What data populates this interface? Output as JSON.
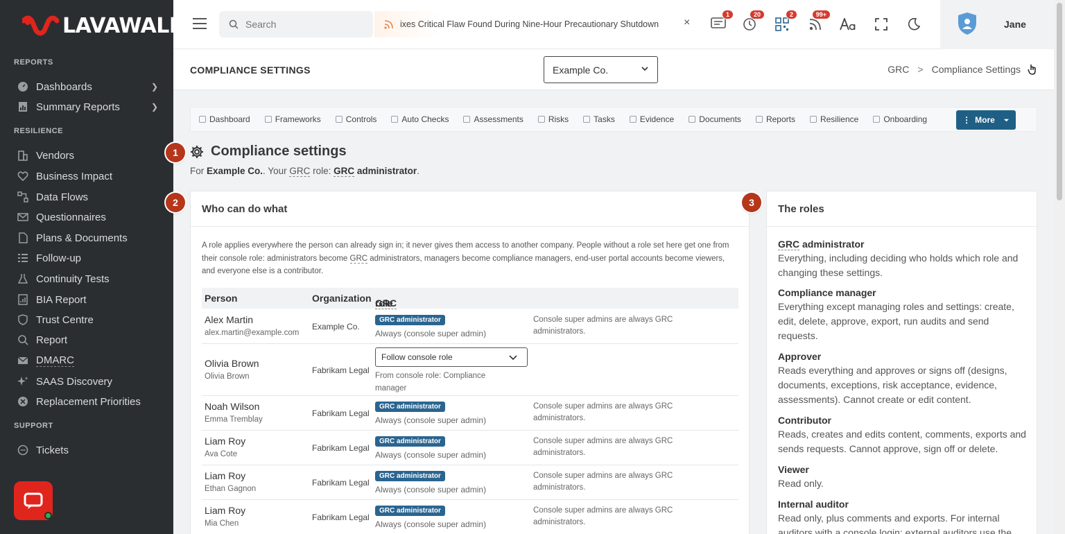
{
  "sidebar": {
    "logo_text": "LAVAWALL",
    "logo_reg": "®",
    "sections": {
      "reports": "REPORTS",
      "resilience": "RESILIENCE",
      "support": "SUPPORT"
    },
    "items": {
      "dashboards": "Dashboards",
      "summary_reports": "Summary Reports",
      "vendors": "Vendors",
      "business_impact": "Business Impact",
      "data_flows": "Data Flows",
      "questionnaires": "Questionnaires",
      "plans_documents": "Plans & Documents",
      "follow_up": "Follow-up",
      "continuity_tests": "Continuity Tests",
      "bia_report": "BIA Report",
      "trust_centre": "Trust Centre",
      "report": "Report",
      "dmarc": "DMARC",
      "saas_discovery": "SAAS Discovery",
      "replacement_priorities": "Replacement Priorities",
      "tickets": "Tickets"
    }
  },
  "topbar": {
    "search_placeholder": "Search",
    "ticker_text": "ixes Critical Flaw Found During Nine-Hour Precautionary Shutdown",
    "ticker_close": "×",
    "badges": {
      "messages": "1",
      "timer": "20",
      "qr": "2",
      "feed": "99+"
    },
    "user_name": "Jane"
  },
  "page_header": {
    "title": "COMPLIANCE SETTINGS",
    "org_selected": "Example Co.",
    "breadcrumb": [
      "GRC",
      "Compliance Settings"
    ],
    "breadcrumb_sep": ">"
  },
  "tabs": {
    "items": [
      "Dashboard",
      "Frameworks",
      "Controls",
      "Auto Checks",
      "Assessments",
      "Risks",
      "Tasks",
      "Evidence",
      "Documents",
      "Reports",
      "Resilience",
      "Onboarding"
    ],
    "more": "More"
  },
  "markers": [
    "1",
    "2",
    "3"
  ],
  "heading": {
    "title": "Compliance settings",
    "sub_prefix": "For ",
    "sub_org": "Example Co.",
    "sub_mid1": ". Your ",
    "sub_grc": "GRC",
    "sub_mid2": " role: ",
    "sub_grc2": "GRC",
    "sub_role": " administrator",
    "sub_end": "."
  },
  "who_card": {
    "title": "Who can do what",
    "intro_1": "A role applies everywhere the person can already sign in; it never gives them access to another company. People without a role set here get one from their console role: administrators become ",
    "intro_grc": "GRC",
    "intro_2": " administrators, managers become compliance managers, end-user portal accounts become viewers, and everyone else is a contributor.",
    "columns": {
      "person": "Person",
      "organization": "Organization",
      "role_grc": "GRC",
      "role": " role"
    },
    "rows": [
      {
        "name": "Alex Martin",
        "sub": "alex.martin@example.com",
        "org": "Example Co.",
        "badge": "GRC administrator",
        "role_sub": "Always (console super admin)",
        "note": "Console super admins are always GRC administrators."
      },
      {
        "name": "Olivia Brown",
        "sub": "Olivia Brown",
        "org": "Fabrikam Legal",
        "select": "Follow console role",
        "role_sub": "From console role: Compliance manager"
      },
      {
        "name": "Noah Wilson",
        "sub": "Emma Tremblay",
        "org": "Fabrikam Legal",
        "badge": "GRC administrator",
        "role_sub": "Always (console super admin)",
        "note": "Console super admins are always GRC administrators."
      },
      {
        "name": "Liam Roy",
        "sub": "Ava Cote",
        "org": "Fabrikam Legal",
        "badge": "GRC administrator",
        "role_sub": "Always (console super admin)",
        "note": "Console super admins are always GRC administrators."
      },
      {
        "name": "Liam Roy",
        "sub": "Ethan Gagnon",
        "org": "Fabrikam Legal",
        "badge": "GRC administrator",
        "role_sub": "Always (console super admin)",
        "note": "Console super admins are always GRC administrators."
      },
      {
        "name": "Liam Roy",
        "sub": "Mia Chen",
        "org": "Fabrikam Legal",
        "badge": "GRC administrator",
        "role_sub": "Always (console super admin)",
        "note": "Console super admins are always GRC administrators."
      }
    ]
  },
  "roles_card": {
    "title": "The roles",
    "roles": [
      {
        "title_grc": "GRC",
        "title": " administrator",
        "desc": "Everything, including deciding who holds which role and changing these settings."
      },
      {
        "title": "Compliance manager",
        "desc": "Everything except managing roles and settings: create, edit, delete, approve, export, run audits and send requests."
      },
      {
        "title": "Approver",
        "desc": "Reads everything and approves or signs off (designs, documents, exceptions, risk acceptance, evidence, assessments). Cannot create or edit content."
      },
      {
        "title": "Contributor",
        "desc": "Reads, creates and edits content, comments, exports and sends requests. Cannot approve, sign off or delete."
      },
      {
        "title": "Viewer",
        "desc": "Read only."
      },
      {
        "title": "Internal auditor",
        "desc": "Read only, plus comments and exports. For internal auditors with a console login; external auditors use the"
      }
    ]
  },
  "colors": {
    "sidebar_bg": "#2b2e31",
    "brand_red": "#e0251d",
    "accent_blue": "#1f5f86",
    "marker": "#b5361b"
  }
}
